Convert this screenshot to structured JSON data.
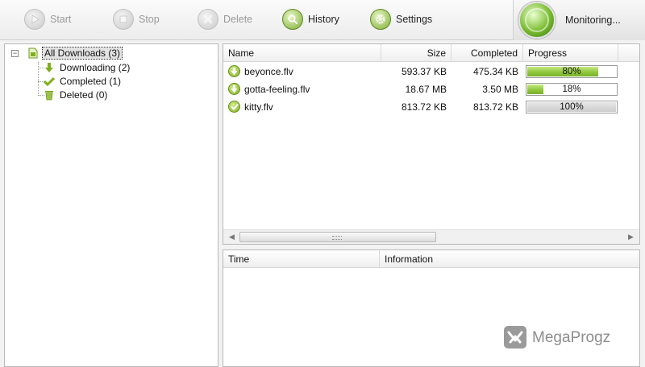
{
  "toolbar": {
    "start_label": "Start",
    "stop_label": "Stop",
    "delete_label": "Delete",
    "history_label": "History",
    "settings_label": "Settings",
    "monitoring_label": "Monitoring..."
  },
  "tree": {
    "root": {
      "label": "All Downloads (3)",
      "icon": "document-icon"
    },
    "children": [
      {
        "label": "Downloading (2)",
        "icon": "download-arrow-icon"
      },
      {
        "label": "Completed (1)",
        "icon": "checkmark-icon"
      },
      {
        "label": "Deleted (0)",
        "icon": "trash-icon"
      }
    ]
  },
  "list": {
    "columns": [
      "Name",
      "Size",
      "Completed",
      "Progress"
    ],
    "rows": [
      {
        "name": "beyonce.flv",
        "size": "593.37 KB",
        "completed": "475.34 KB",
        "progress": "80%",
        "progress_value": 0.8,
        "status": "downloading"
      },
      {
        "name": "gotta-feeling.flv",
        "size": "18.67 MB",
        "completed": "3.50 MB",
        "progress": "18%",
        "progress_value": 0.18,
        "status": "downloading"
      },
      {
        "name": "kitty.flv",
        "size": "813.72 KB",
        "completed": "813.72 KB",
        "progress": "100%",
        "progress_value": 1.0,
        "status": "completed"
      }
    ]
  },
  "log": {
    "columns": [
      "Time",
      "Information"
    ]
  },
  "watermark": {
    "text": "MegaProgz"
  },
  "colors": {
    "accent_green": "#8cc43a",
    "brand_gray": "#8d8d8d"
  }
}
